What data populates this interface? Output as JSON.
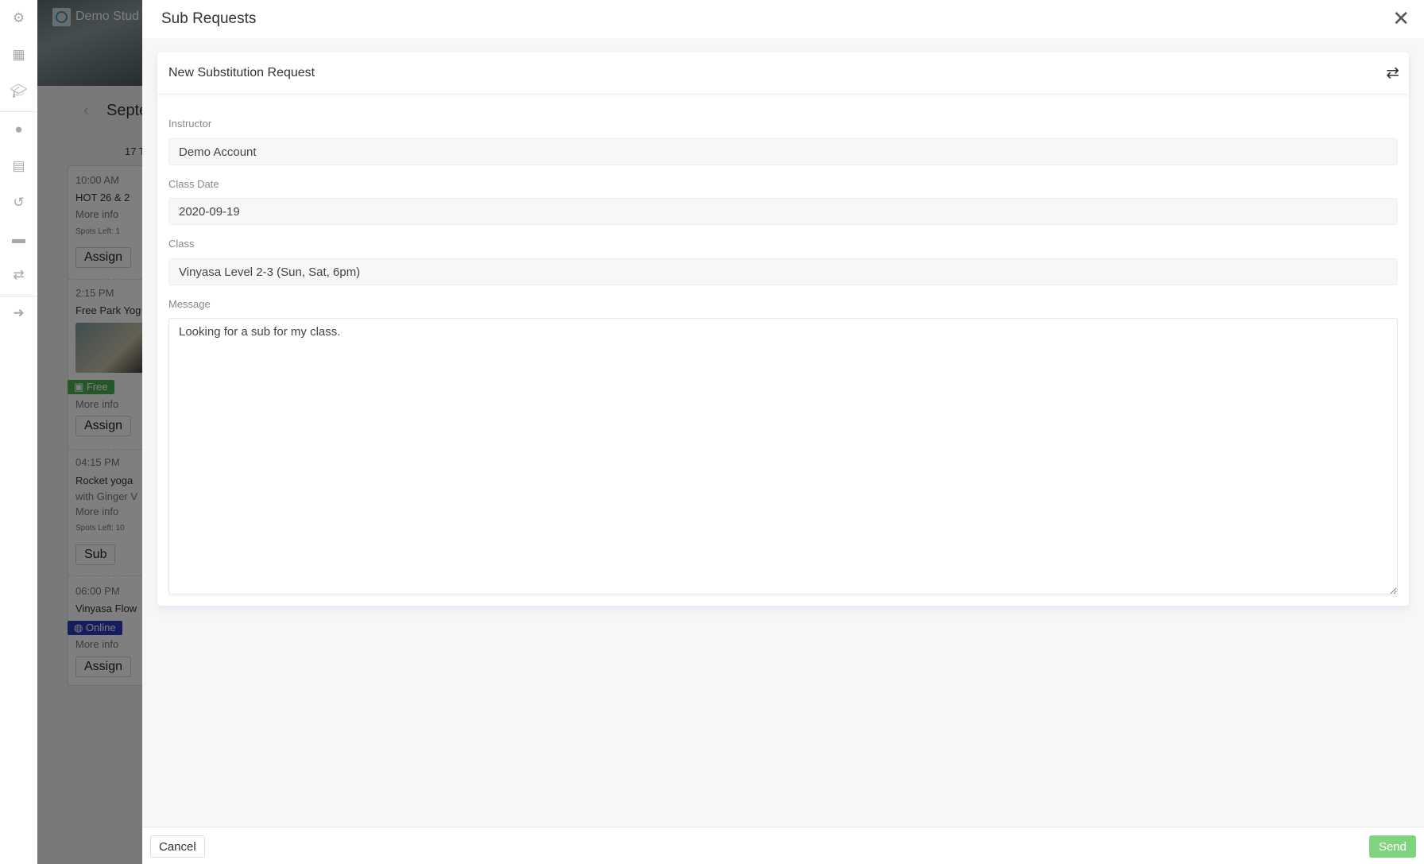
{
  "sidebar": {
    "icons": [
      "gears-icon",
      "sitemap-icon",
      "graduation-cap-icon",
      "user-icon",
      "calendar-icon",
      "history-icon",
      "money-icon",
      "exchange-icon",
      "sign-out-icon"
    ]
  },
  "background": {
    "brand": "Demo Stud",
    "month": "Septe",
    "day": "17 T",
    "classes": [
      {
        "time": "10:00 AM",
        "name": "HOT 26 & 2",
        "more": "More info",
        "spots": "Spots Left: 1",
        "action": "Assign"
      },
      {
        "time": "2:15 PM",
        "name": "Free Park Yog",
        "badge": "Free",
        "more": "More info",
        "action": "Assign"
      },
      {
        "time": "04:15 PM",
        "name": "Rocket yoga",
        "sub": "with Ginger V",
        "more": "More info",
        "spots": "Spots Left: 10",
        "action": "Sub"
      },
      {
        "time": "06:00 PM",
        "name": "Vinyasa Flow",
        "badge": "Online",
        "more": "More info",
        "action": "Assign"
      }
    ],
    "colors": {
      "free": "#4caf50",
      "online": "#2b3bb8"
    }
  },
  "modal": {
    "title": "Sub Requests",
    "card_title": "New Substitution Request",
    "fields": {
      "instructor": {
        "label": "Instructor",
        "value": "Demo Account"
      },
      "class_date": {
        "label": "Class Date",
        "value": "2020-09-19"
      },
      "class": {
        "label": "Class",
        "value": "Vinyasa Level 2-3 (Sun, Sat, 6pm)"
      },
      "message": {
        "label": "Message",
        "value": "Looking for a sub for my class."
      }
    },
    "cancel": "Cancel",
    "send": "Send",
    "send_color": "#80d47f"
  }
}
